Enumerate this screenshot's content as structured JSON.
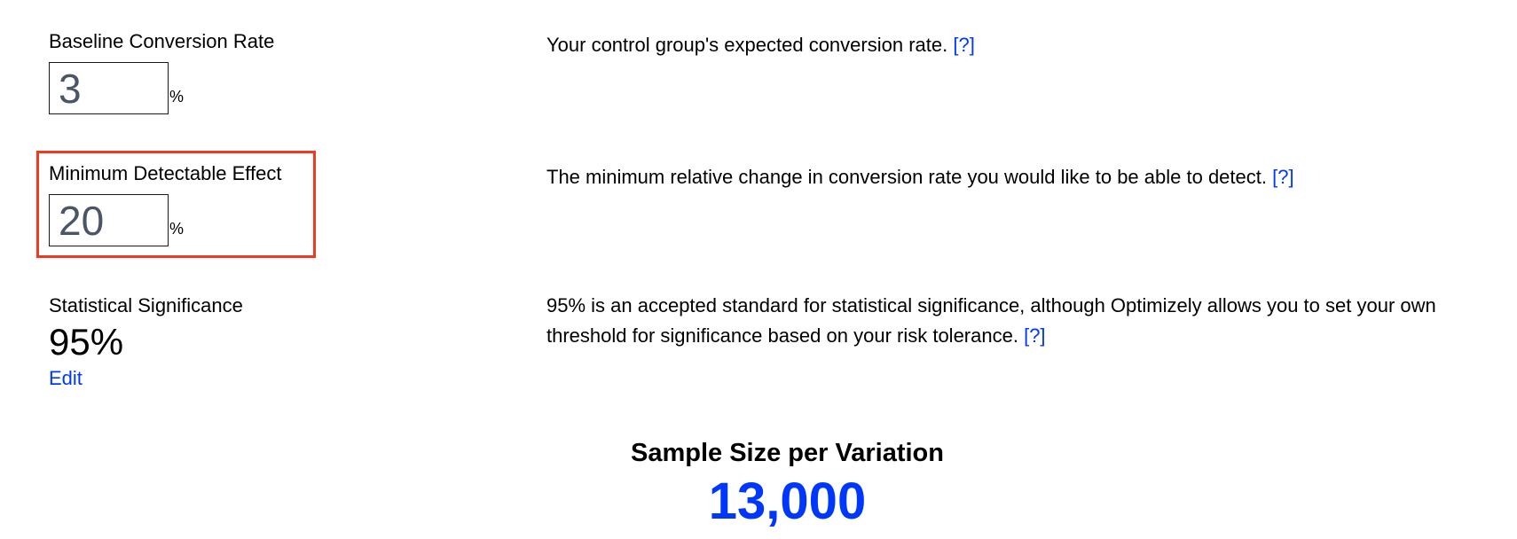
{
  "baseline": {
    "label": "Baseline Conversion Rate",
    "value": "3",
    "unit": "%",
    "description": "Your control group's expected conversion rate.",
    "help_link": "[?]"
  },
  "mde": {
    "label": "Minimum Detectable Effect",
    "value": "20",
    "unit": "%",
    "description": "The minimum relative change in conversion rate you would like to be able to detect.",
    "help_link": "[?]"
  },
  "significance": {
    "label": "Statistical Significance",
    "value": "95%",
    "edit_label": "Edit",
    "description": "95% is an accepted standard for statistical significance, although Optimizely allows you to set your own threshold for significance based on your risk tolerance.",
    "help_link": "[?]"
  },
  "result": {
    "title": "Sample Size per Variation",
    "value": "13,000"
  },
  "colors": {
    "link": "#0037ff",
    "highlight": "#ef3a1f",
    "input_text": "#4a5568"
  }
}
